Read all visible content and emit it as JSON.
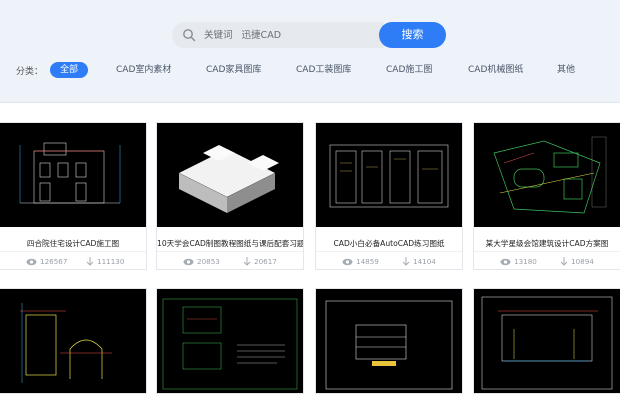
{
  "search": {
    "placeholder": "关键词   迅捷CAD",
    "button_label": "搜索"
  },
  "categories": {
    "label": "分类：",
    "items": [
      "全部",
      "CAD室内素材",
      "CAD家具图库",
      "CAD工装图库",
      "CAD施工图",
      "CAD机械图纸",
      "其他"
    ],
    "active": "全部"
  },
  "cards": [
    {
      "title": "四合院住宅设计CAD施工图",
      "views": "126567",
      "downloads": "111130"
    },
    {
      "title": "10天学会CAD制图教程图纸与课后配套习题",
      "views": "20853",
      "downloads": "20617"
    },
    {
      "title": "CAD小白必备AutoCAD练习图纸",
      "views": "14859",
      "downloads": "14104"
    },
    {
      "title": "某大学星级会馆建筑设计CAD方案图",
      "views": "13180",
      "downloads": "10894"
    }
  ],
  "colors": {
    "accent": "#2e7cf6",
    "header_bg": "#eef3fa",
    "thumb_bg": "#000000"
  }
}
